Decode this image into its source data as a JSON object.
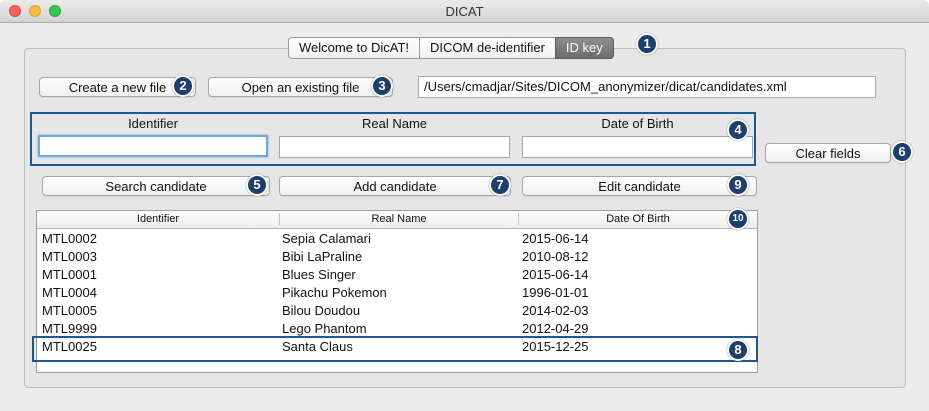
{
  "window": {
    "title": "DICAT"
  },
  "tabs": [
    {
      "label": "Welcome to DicAT!"
    },
    {
      "label": "DICOM de-identifier"
    },
    {
      "label": "ID key"
    }
  ],
  "file": {
    "create_label": "Create a new file",
    "open_label": "Open an existing file",
    "path": "/Users/cmadjar/Sites/DICOM_anonymizer/dicat/candidates.xml"
  },
  "fields": {
    "identifier_label": "Identifier",
    "realname_label": "Real Name",
    "dob_label": "Date of Birth",
    "identifier_value": "",
    "realname_value": "",
    "dob_value": ""
  },
  "actions": {
    "clear_label": "Clear fields",
    "search_label": "Search candidate",
    "add_label": "Add candidate",
    "edit_label": "Edit candidate"
  },
  "table": {
    "columns": [
      "Identifier",
      "Real Name",
      "Date Of Birth"
    ],
    "rows": [
      [
        "MTL0002",
        "Sepia Calamari",
        "2015-06-14"
      ],
      [
        "MTL0003",
        "Bibi LaPraline",
        "2010-08-12"
      ],
      [
        "MTL0001",
        "Blues Singer",
        "2015-06-14"
      ],
      [
        "MTL0004",
        "Pikachu Pokemon",
        "1996-01-01"
      ],
      [
        "MTL0005",
        "Bilou Doudou",
        "2014-02-03"
      ],
      [
        "MTL9999",
        "Lego Phantom",
        "2012-04-29"
      ],
      [
        "MTL0025",
        "Santa Claus",
        "2015-12-25"
      ]
    ]
  },
  "badges": [
    "1",
    "2",
    "3",
    "4",
    "5",
    "6",
    "7",
    "8",
    "9",
    "10"
  ],
  "colors": {
    "badge": "#1d3f6e",
    "highlight": "#1f5792",
    "active_tab": "#7a7a7a",
    "focus": "#6fa7de"
  }
}
